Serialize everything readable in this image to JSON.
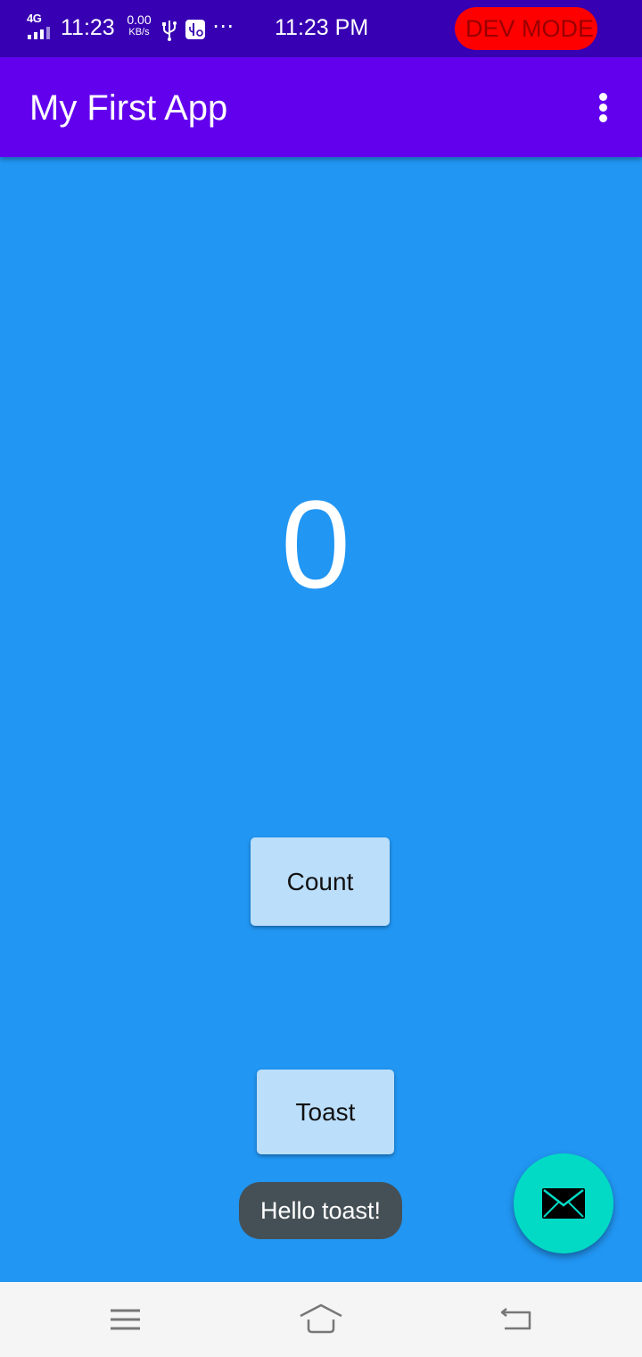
{
  "status_bar": {
    "network": "4G",
    "time_left": "11:23",
    "speed_value": "0.00",
    "speed_unit": "KB/s",
    "more_icon": "⋯",
    "time_center": "11:23 PM",
    "dev_badge": "DEV MODE",
    "icons": [
      "signal-icon",
      "usb-icon",
      "usb-debug-icon",
      "more-dots-icon"
    ]
  },
  "app_bar": {
    "title": "My First App",
    "overflow_icon": "overflow-menu-icon"
  },
  "content": {
    "counter": "0",
    "count_button": "Count",
    "toast_button": "Toast",
    "toast_message": "Hello toast!",
    "fab_icon": "email-icon"
  },
  "nav_bar": {
    "icons": [
      "menu-icon",
      "home-icon",
      "back-icon"
    ]
  },
  "colors": {
    "status_bar": "#3700B3",
    "app_bar": "#6200EE",
    "background": "#2196F3",
    "button": "#BBDEFB",
    "fab": "#03DAC5",
    "toast": "#455056",
    "dev_badge": "#FF0000",
    "nav_bar": "#F5F5F5"
  }
}
